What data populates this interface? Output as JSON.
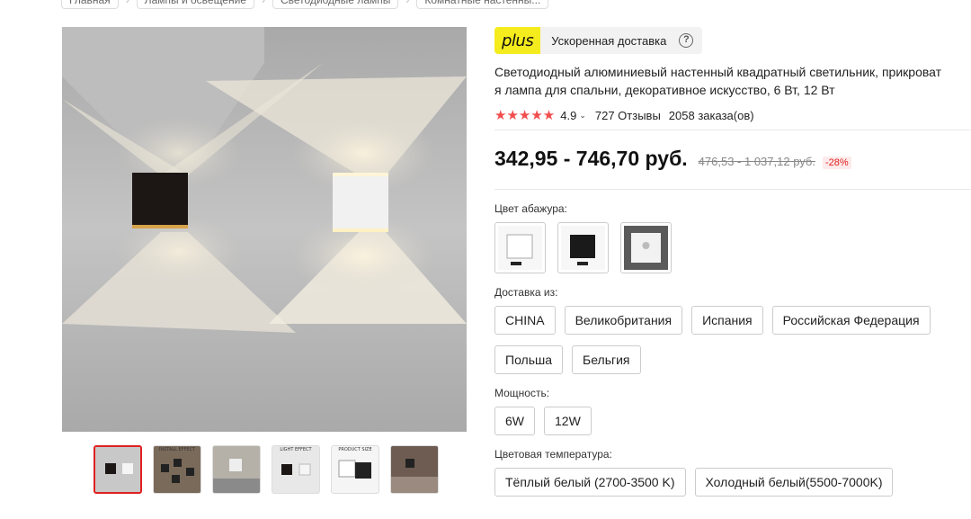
{
  "breadcrumb": [
    "Главная",
    "Лампы и освещение",
    "Светодиодные лампы",
    "Комнатные настенны..."
  ],
  "plus": {
    "logo": "plus",
    "text": "Ускоренная доставка",
    "help": "?"
  },
  "product": {
    "title_line1": "Светодиодный алюминиевый настенный квадратный светильник, прикроват",
    "title_line2": "я лампа для спальни, декоративное искусство, 6 Вт, 12 Вт",
    "stars": "★★★★★",
    "rating": "4.9",
    "reviews": "727 Отзывы",
    "orders": "2058 заказа(ов)",
    "price": "342,95 - 746,70 руб.",
    "old_price": "476,53 - 1 037,12 руб.",
    "discount": "-28%"
  },
  "thumbnails": [
    {
      "label": ""
    },
    {
      "label": "INSTALL EFFECT"
    },
    {
      "label": ""
    },
    {
      "label": "LIGHT EFFECT"
    },
    {
      "label": "PRODUCT SIZE"
    },
    {
      "label": ""
    }
  ],
  "shade_color": {
    "label": "Цвет абажура:",
    "options": [
      "white",
      "black",
      "dimming"
    ]
  },
  "ship_from": {
    "label": "Доставка из:",
    "options": [
      "CHINA",
      "Великобритания",
      "Испания",
      "Российская Федерация",
      "Польша",
      "Бельгия"
    ]
  },
  "power": {
    "label": "Мощность:",
    "options": [
      "6W",
      "12W"
    ]
  },
  "color_temp": {
    "label": "Цветовая температура:",
    "options": [
      "Тёплый белый (2700-3500 K)",
      "Холодный белый(5500-7000K)"
    ]
  },
  "colors": {
    "accent_red": "#e02020",
    "star_red": "#f24d4d",
    "plus_yellow": "#f5ec1d"
  }
}
